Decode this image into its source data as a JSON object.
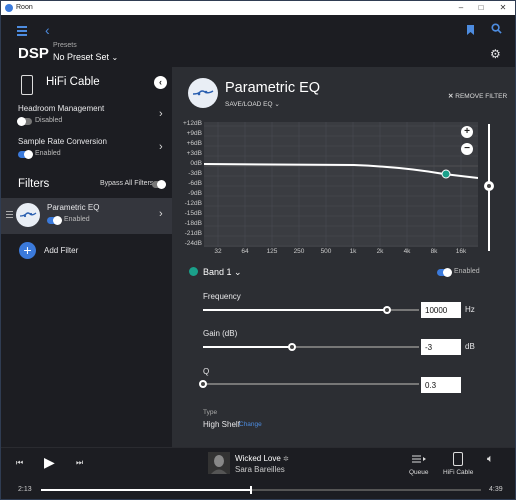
{
  "window": {
    "title": "Roon"
  },
  "header": {
    "page_title": "DSP",
    "presets_label": "Presets",
    "presets_value": "No Preset Set"
  },
  "sidebar": {
    "zone_title": "HiFi Cable",
    "headroom": {
      "label": "Headroom Management",
      "status": "Disabled"
    },
    "sample_rate": {
      "label": "Sample Rate Conversion",
      "status": "Enabled"
    },
    "filters_title": "Filters",
    "bypass_label": "Bypass All Filters",
    "filter_item": {
      "label": "Parametric EQ",
      "status": "Enabled"
    },
    "add_filter_label": "Add Filter"
  },
  "main": {
    "title": "Parametric EQ",
    "saveload_label": "SAVE/LOAD EQ",
    "remove_label": "REMOVE FILTER",
    "band_label": "Band 1",
    "band_enabled_label": "Enabled",
    "frequency": {
      "label": "Frequency",
      "value": "10000",
      "unit": "Hz",
      "fraction": 0.85
    },
    "gain": {
      "label": "Gain (dB)",
      "value": "-3",
      "unit": "dB",
      "fraction": 0.41
    },
    "q": {
      "label": "Q",
      "value": "0.3",
      "fraction": 0.0
    },
    "type": {
      "label": "Type",
      "value": "High Shelf",
      "change_label": "Change"
    }
  },
  "graph": {
    "y_labels": [
      "+12dB",
      "+9dB",
      "+6dB",
      "+3dB",
      "0dB",
      "-3dB",
      "-6dB",
      "-9dB",
      "-12dB",
      "-15dB",
      "-18dB",
      "-21dB",
      "-24dB"
    ],
    "x_labels": [
      "32",
      "64",
      "125",
      "250",
      "500",
      "1k",
      "2k",
      "4k",
      "8k",
      "16k"
    ],
    "zoom_in_label": "+",
    "zoom_out_label": "−"
  },
  "player": {
    "song": "Wicked Love",
    "artist": "Sara Bareilles",
    "elapsed": "2:13",
    "duration": "4:39",
    "progress": 0.477,
    "queue_label": "Queue",
    "zone_label": "HiFi Cable"
  },
  "colors": {
    "accent": "#3b7adb",
    "band": "#1aa08a",
    "panel": "#2c2e33"
  }
}
